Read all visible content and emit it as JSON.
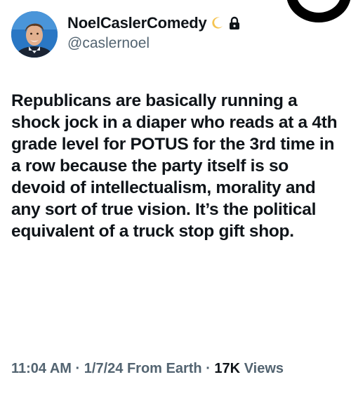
{
  "author": {
    "display_name": "NoelCaslerComedy",
    "handle": "@caslernoel",
    "badge_icons": [
      "crescent-moon-emoji",
      "lock-icon"
    ]
  },
  "tweet": {
    "text": "Republicans are basically running a shock jock in a diaper who reads at a 4th grade level for POTUS for the 3rd time in a row because the party itself is so devoid of intellectualism, morality and any sort of true vision. It’s the political equivalent of a truck stop gift shop."
  },
  "meta": {
    "time": "11:04 AM",
    "separator": "·",
    "date": "1/7/24",
    "source": "From Earth",
    "views_count": "17K",
    "views_label": "Views"
  },
  "colors": {
    "text_primary": "#0f1419",
    "text_secondary": "#536471",
    "moon": "#f5c451"
  }
}
